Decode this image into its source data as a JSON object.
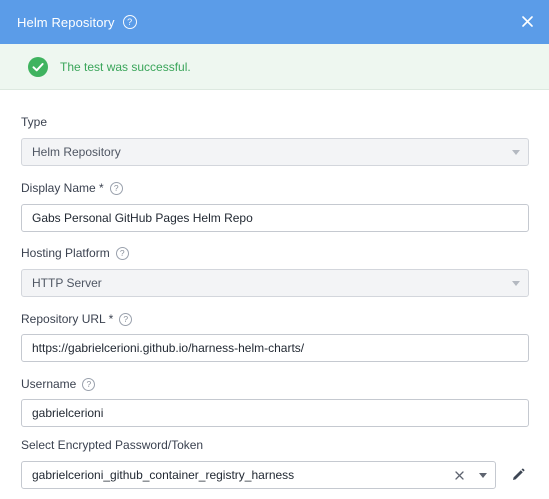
{
  "header": {
    "title": "Helm Repository",
    "help_icon": "?"
  },
  "banner": {
    "message": "The test was successful."
  },
  "form": {
    "type": {
      "label": "Type",
      "value": "Helm Repository"
    },
    "display_name": {
      "label": "Display Name *",
      "value": "Gabs Personal GitHub Pages Helm Repo"
    },
    "hosting_platform": {
      "label": "Hosting Platform",
      "value": "HTTP Server"
    },
    "repository_url": {
      "label": "Repository URL *",
      "value": "https://gabrielcerioni.github.io/harness-helm-charts/"
    },
    "username": {
      "label": "Username",
      "value": "gabrielcerioni"
    },
    "password": {
      "label": "Select Encrypted Password/Token",
      "value": "gabrielcerioni_github_container_registry_harness"
    }
  },
  "help_glyph": "?",
  "colors": {
    "header_bg": "#5b9ce8",
    "success_bg": "#eef7f0",
    "success_text": "#3aa55a"
  }
}
